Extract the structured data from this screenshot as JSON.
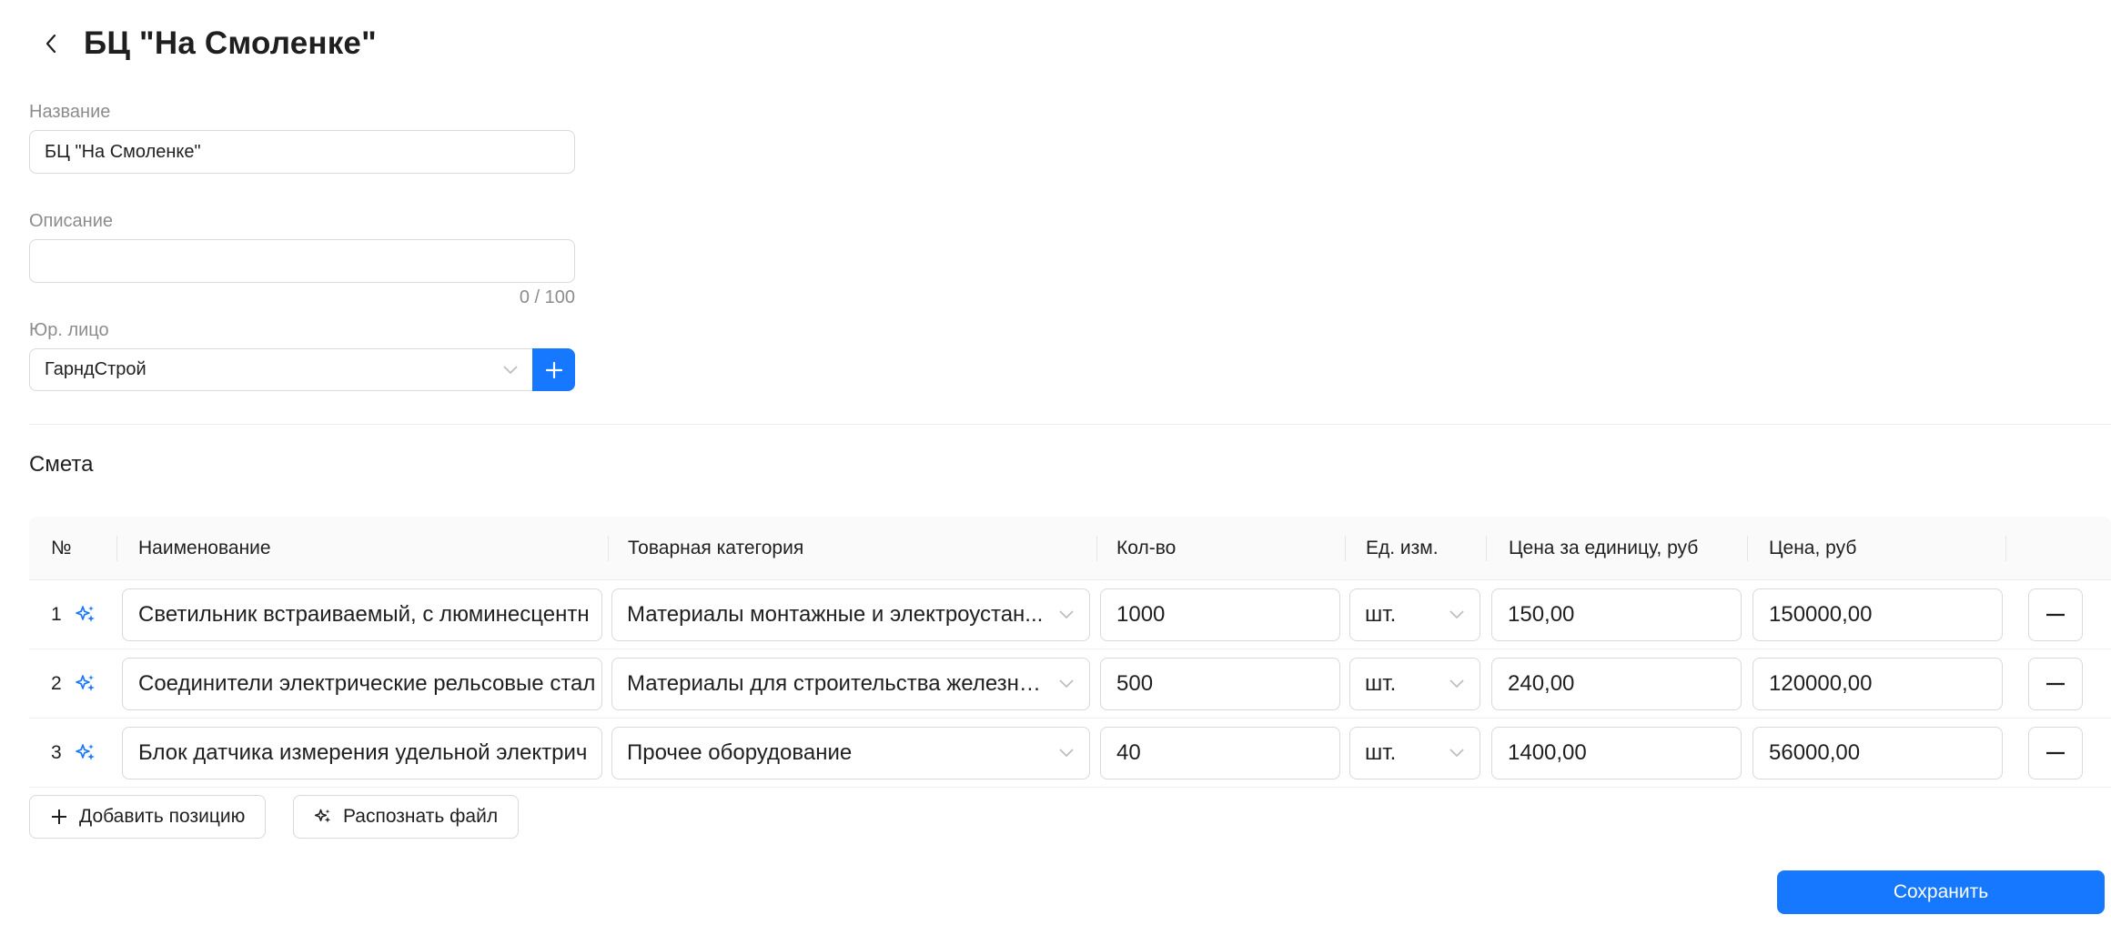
{
  "header": {
    "title": "БЦ \"На Смоленке\""
  },
  "form": {
    "name_label": "Название",
    "name_value": "БЦ \"На Смоленке\"",
    "description_label": "Описание",
    "description_value": "",
    "description_counter": "0 / 100",
    "legal_entity_label": "Юр. лицо",
    "legal_entity_value": "ГарндСтрой"
  },
  "estimate": {
    "title": "Смета",
    "columns": {
      "num": "№",
      "name": "Наименование",
      "category": "Товарная категория",
      "qty": "Кол-во",
      "unit": "Ед. изм.",
      "unit_price": "Цена за единицу, руб",
      "price": "Цена, руб"
    },
    "rows": [
      {
        "num": "1",
        "name": "Светильник встраиваемый, с люминесцентн",
        "category": "Материалы монтажные и электроустан...",
        "qty": "1000",
        "unit": "шт.",
        "unit_price": "150,00",
        "price": "150000,00"
      },
      {
        "num": "2",
        "name": "Соединители электрические рельсовые стал",
        "category": "Материалы для строительства железны...",
        "qty": "500",
        "unit": "шт.",
        "unit_price": "240,00",
        "price": "120000,00"
      },
      {
        "num": "3",
        "name": "Блок датчика измерения удельной электрич",
        "category": "Прочее оборудование",
        "qty": "40",
        "unit": "шт.",
        "unit_price": "1400,00",
        "price": "56000,00"
      }
    ],
    "add_position_label": "Добавить позицию",
    "recognize_file_label": "Распознать файл"
  },
  "footer": {
    "save_label": "Сохранить"
  },
  "colors": {
    "primary": "#1677ff",
    "border": "#d9d9d9",
    "muted_text": "#8c8c8c"
  },
  "icons": {
    "back": "chevron-left-icon",
    "add": "plus-icon",
    "dropdown": "chevron-down-icon",
    "ai": "sparkle-icon",
    "remove": "minus-icon"
  }
}
